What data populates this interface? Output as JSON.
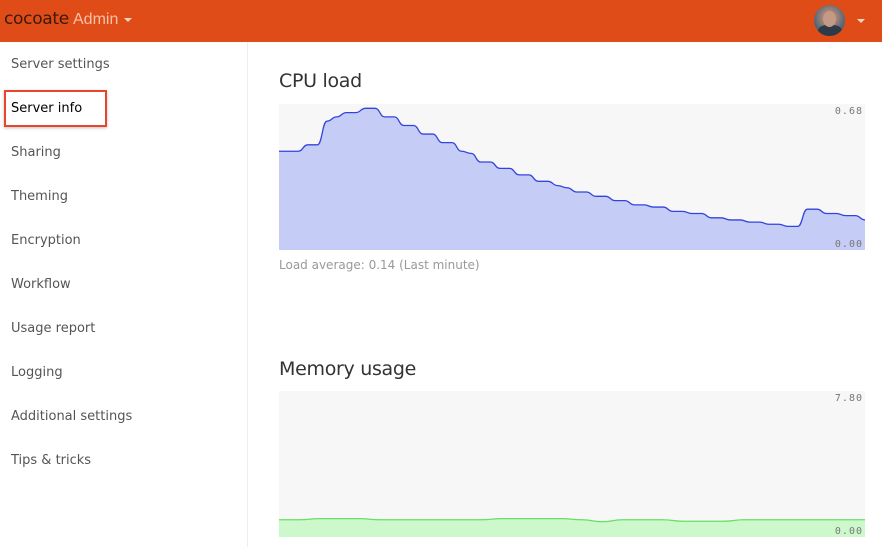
{
  "header": {
    "logo": "cocoate",
    "app_name": "Admin",
    "user_menu_icon": "avatar-photo",
    "colors": {
      "brand": "#e04c17"
    }
  },
  "sidebar": {
    "active_index": 1,
    "items": [
      {
        "label": "Server settings"
      },
      {
        "label": "Server info"
      },
      {
        "label": "Sharing"
      },
      {
        "label": "Theming"
      },
      {
        "label": "Encryption"
      },
      {
        "label": "Workflow"
      },
      {
        "label": "Usage report"
      },
      {
        "label": "Logging"
      },
      {
        "label": "Additional settings"
      },
      {
        "label": "Tips & tricks"
      }
    ]
  },
  "main": {
    "cpu": {
      "title": "CPU load",
      "caption": "Load average: 0.14 (Last minute)"
    },
    "memory": {
      "title": "Memory usage"
    }
  },
  "chart_data": [
    {
      "type": "area",
      "title": "CPU load",
      "ylim": [
        0,
        0.68
      ],
      "ytick_labels": [
        "0.68",
        "0.00"
      ],
      "color_line": "#3344dd",
      "color_fill": "#c5ccf6",
      "background": "#f7f7f7",
      "grid": false,
      "values": [
        0.46,
        0.46,
        0.46,
        0.49,
        0.49,
        0.6,
        0.62,
        0.64,
        0.64,
        0.66,
        0.66,
        0.62,
        0.62,
        0.58,
        0.58,
        0.54,
        0.54,
        0.5,
        0.5,
        0.46,
        0.45,
        0.41,
        0.41,
        0.38,
        0.38,
        0.35,
        0.35,
        0.32,
        0.32,
        0.3,
        0.29,
        0.27,
        0.27,
        0.25,
        0.25,
        0.23,
        0.23,
        0.21,
        0.21,
        0.2,
        0.2,
        0.18,
        0.18,
        0.17,
        0.17,
        0.15,
        0.15,
        0.14,
        0.14,
        0.13,
        0.13,
        0.12,
        0.12,
        0.11,
        0.11,
        0.19,
        0.19,
        0.17,
        0.17,
        0.16,
        0.16,
        0.14
      ]
    },
    {
      "type": "area",
      "title": "Memory usage",
      "ylim": [
        0,
        7.8
      ],
      "ytick_labels": [
        "7.80",
        "0.00"
      ],
      "color_line": "#66e066",
      "color_fill": "#ccf8cc",
      "background": "#f7f7f7",
      "grid": false,
      "values": [
        0.92,
        0.92,
        0.98,
        0.98,
        0.98,
        0.92,
        0.92,
        0.92,
        0.92,
        0.92,
        0.92,
        0.98,
        0.98,
        0.98,
        0.98,
        0.92,
        0.82,
        0.92,
        0.92,
        0.92,
        0.84,
        0.84,
        0.84,
        0.92,
        0.92,
        0.92,
        0.92,
        0.92,
        0.92,
        0.92
      ]
    }
  ]
}
